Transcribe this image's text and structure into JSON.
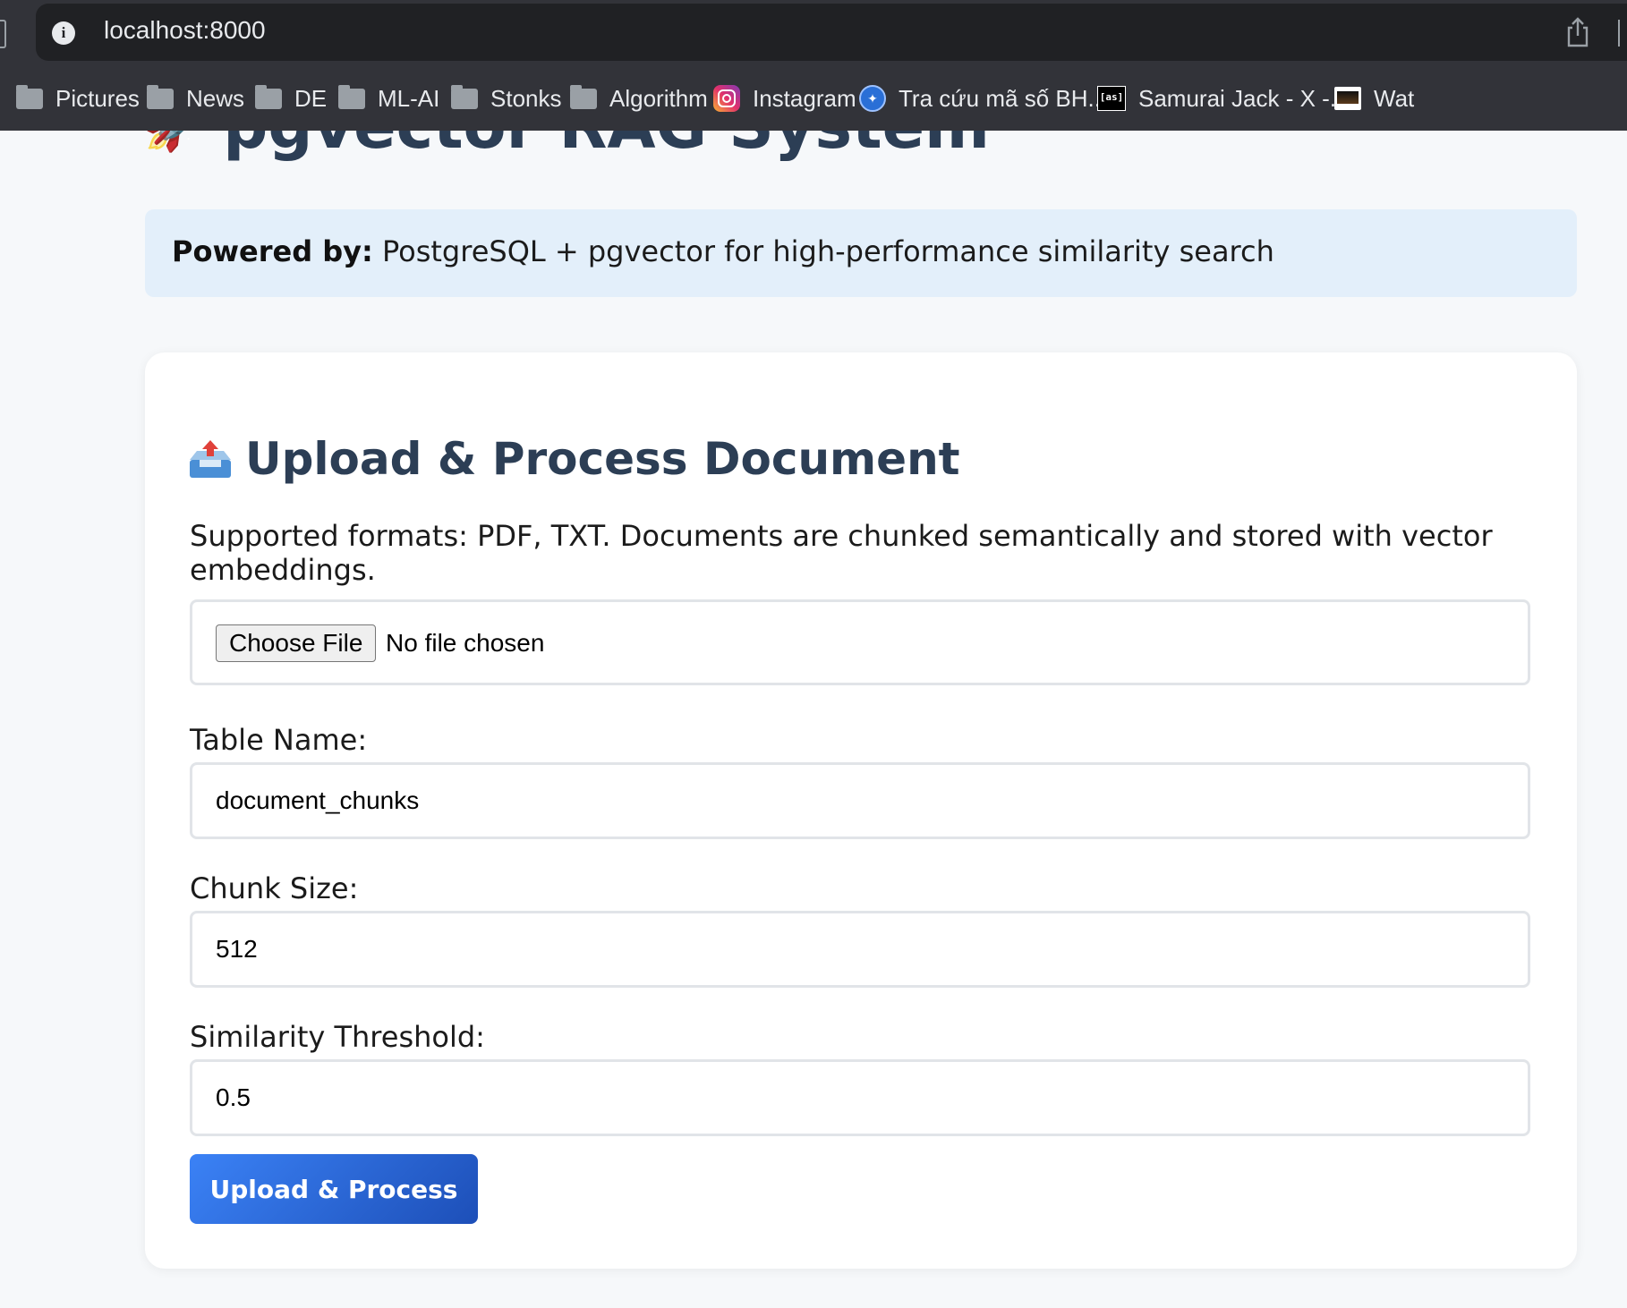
{
  "browser": {
    "url": "localhost:8000",
    "bookmarks": [
      {
        "label": "Pictures",
        "icon": "folder-icon"
      },
      {
        "label": "News",
        "icon": "folder-icon"
      },
      {
        "label": "DE",
        "icon": "folder-icon"
      },
      {
        "label": "ML-AI",
        "icon": "folder-icon"
      },
      {
        "label": "Stonks",
        "icon": "folder-icon"
      },
      {
        "label": "Algorithm",
        "icon": "folder-icon"
      },
      {
        "label": "Instagram",
        "icon": "instagram-icon"
      },
      {
        "label": "Tra cứu mã số BH...",
        "icon": "bhxh-icon"
      },
      {
        "label": "Samurai Jack - X -...",
        "icon": "as-icon"
      },
      {
        "label": "Wat",
        "icon": "site-icon"
      }
    ]
  },
  "page": {
    "title": "pgvector RAG System",
    "title_icon": "rocket-icon",
    "powered_label": "Powered by:",
    "powered_text": " PostgreSQL + pgvector for high-performance similarity search"
  },
  "upload": {
    "title": "Upload & Process Document",
    "title_icon": "inbox-tray-icon",
    "description": "Supported formats: PDF, TXT. Documents are chunked semantically and stored with vector embeddings.",
    "file_button": "Choose File",
    "file_status": "No file chosen",
    "table_name_label": "Table Name:",
    "table_name_value": "document_chunks",
    "chunk_size_label": "Chunk Size:",
    "chunk_size_value": "512",
    "threshold_label": "Similarity Threshold:",
    "threshold_value": "0.5",
    "submit_label": "Upload & Process"
  },
  "colors": {
    "heading": "#2c3e55",
    "powered_bg": "#e3effa",
    "button_start": "#3b82f6",
    "button_end": "#1d4fb8"
  }
}
